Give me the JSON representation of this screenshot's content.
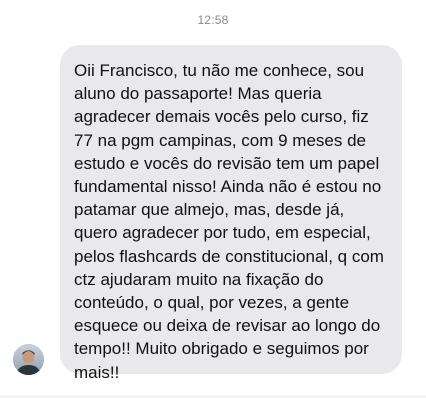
{
  "thread": {
    "timestamp": "12:58",
    "messages": [
      {
        "direction": "incoming",
        "text": "Oii Francisco, tu não me conhece, sou aluno do passaporte! Mas queria agradecer demais vocês pelo curso, fiz 77 na pgm campinas, com 9 meses de estudo e vocês do revisão tem um papel fundamental nisso! Ainda não é estou no patamar que almejo, mas, desde já, quero agradecer por tudo, em especial, pelos flashcards de constitucional, q com ctz ajudaram muito na fixação do conteúdo, o qual, por vezes, a gente esquece ou deixa de revisar ao longo do tempo!! Muito obrigado e seguimos por mais!!",
        "bubble_color": "#e9e9eb",
        "sender_avatar": "profile-photo-avatar"
      }
    ]
  },
  "colors": {
    "background": "#ffffff",
    "timestamp": "#8a8a8e",
    "text": "#111111"
  }
}
